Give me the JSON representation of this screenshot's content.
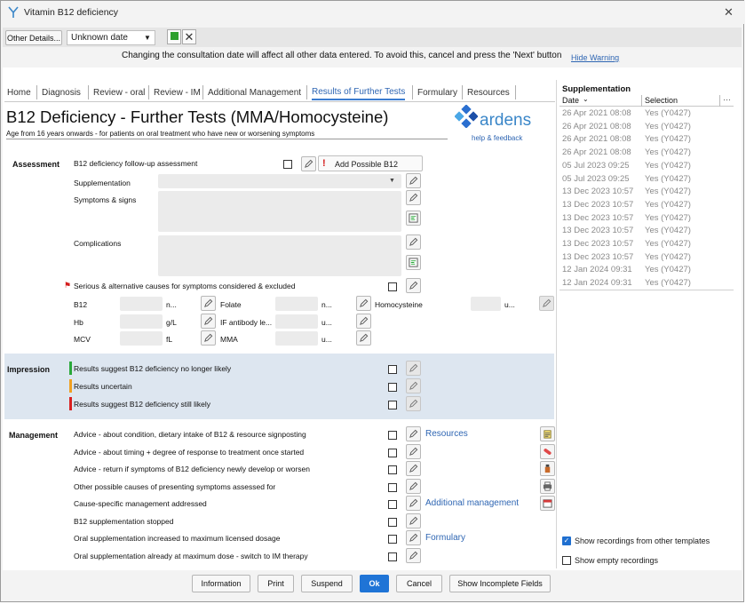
{
  "window": {
    "title": "Vitamin B12 deficiency",
    "close_glyph": "✕"
  },
  "toolbar": {
    "other_details": "Other Details...",
    "date_value": "Unknown date"
  },
  "warning": {
    "text": "Changing the consultation date will affect all other data entered. To avoid this, cancel and press the 'Next' button",
    "hide_link": "Hide Warning"
  },
  "tabs": [
    {
      "label": "Home"
    },
    {
      "label": "Diagnosis"
    },
    {
      "label": "Review - oral"
    },
    {
      "label": "Review - IM"
    },
    {
      "label": "Additional Management"
    },
    {
      "label": "Results of Further Tests"
    },
    {
      "label": "Formulary"
    },
    {
      "label": "Resources"
    }
  ],
  "page": {
    "title": "B12 Deficiency - Further Tests (MMA/Homocysteine)",
    "subtitle": "Age from 16 years onwards - for patients on oral treatment who have new or worsening symptoms",
    "brand": "ardens",
    "help": "help & feedback"
  },
  "assessment": {
    "heading": "Assessment",
    "followup": "B12 deficiency follow-up assessment",
    "add_b12": "Add Possible B12",
    "supplementation": "Supplementation",
    "symptoms": "Symptoms & signs",
    "complications": "Complications",
    "serious": "Serious & alternative causes for symptoms considered & excluded",
    "tests": {
      "b12": "B12",
      "b12_unit": "n...",
      "hb": "Hb",
      "hb_unit": "g/L",
      "mcv": "MCV",
      "mcv_unit": "fL",
      "folate": "Folate",
      "folate_unit": "n...",
      "if_ab": "IF antibody le...",
      "if_unit": "u...",
      "mma": "MMA",
      "mma_unit": "u...",
      "homocysteine": "Homocysteine",
      "homo_unit": "u..."
    }
  },
  "impression": {
    "heading": "Impression",
    "items": [
      {
        "label": "Results suggest B12 deficiency no longer likely",
        "color": "#2aa83a"
      },
      {
        "label": "Results uncertain",
        "color": "#f0a020"
      },
      {
        "label": "Results suggest B12 deficiency still likely",
        "color": "#d92020"
      }
    ]
  },
  "management": {
    "heading": "Management",
    "items": [
      {
        "label": "Advice - about condition, dietary intake of B12 & resource signposting"
      },
      {
        "label": "Advice - about timing + degree of response to treatment once started"
      },
      {
        "label": "Advice - return if symptoms of B12 deficiency newly develop or worsen"
      },
      {
        "label": "Other possible causes of presenting symptoms assessed for"
      },
      {
        "label": "Cause-specific management addressed"
      },
      {
        "label": "B12 supplementation stopped"
      },
      {
        "label": "Oral supplementation increased to maximum licensed dosage"
      },
      {
        "label": "Oral supplementation already at maximum dose - switch to IM therapy"
      }
    ],
    "links": {
      "resources": "Resources",
      "additional": "Additional management",
      "formulary": "Formulary"
    }
  },
  "right_panel": {
    "title": "Supplementation",
    "col_date": "Date",
    "col_selection": "Selection",
    "rows": [
      {
        "date": "26 Apr 2021 08:08",
        "sel": "Yes (Y0427)"
      },
      {
        "date": "26 Apr 2021 08:08",
        "sel": "Yes (Y0427)"
      },
      {
        "date": "26 Apr 2021 08:08",
        "sel": "Yes (Y0427)"
      },
      {
        "date": "26 Apr 2021 08:08",
        "sel": "Yes (Y0427)"
      },
      {
        "date": "05 Jul 2023 09:25",
        "sel": "Yes (Y0427)"
      },
      {
        "date": "05 Jul 2023 09:25",
        "sel": "Yes (Y0427)"
      },
      {
        "date": "13 Dec 2023 10:57",
        "sel": "Yes (Y0427)"
      },
      {
        "date": "13 Dec 2023 10:57",
        "sel": "Yes (Y0427)"
      },
      {
        "date": "13 Dec 2023 10:57",
        "sel": "Yes (Y0427)"
      },
      {
        "date": "13 Dec 2023 10:57",
        "sel": "Yes (Y0427)"
      },
      {
        "date": "13 Dec 2023 10:57",
        "sel": "Yes (Y0427)"
      },
      {
        "date": "13 Dec 2023 10:57",
        "sel": "Yes (Y0427)"
      },
      {
        "date": "12 Jan 2024 09:31",
        "sel": "Yes (Y0427)"
      },
      {
        "date": "12 Jan 2024 09:31",
        "sel": "Yes (Y0427)"
      }
    ],
    "show_other": "Show recordings from other templates",
    "show_empty": "Show empty recordings"
  },
  "footer": {
    "information": "Information",
    "print": "Print",
    "suspend": "Suspend",
    "ok": "Ok",
    "cancel": "Cancel",
    "show_incomplete": "Show Incomplete Fields"
  }
}
